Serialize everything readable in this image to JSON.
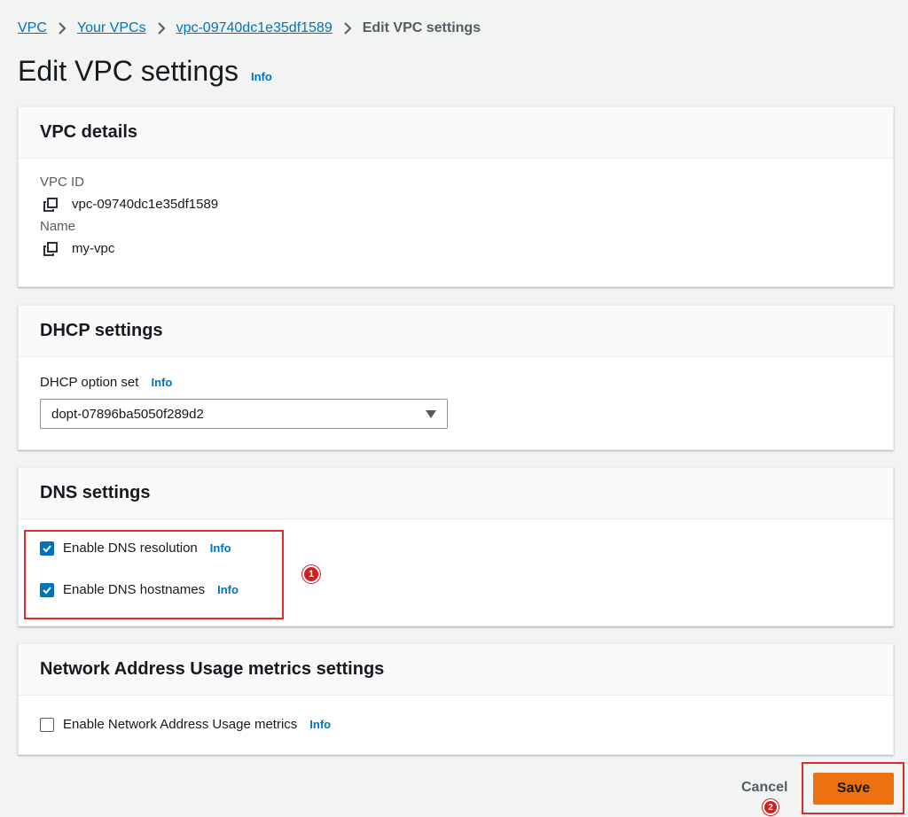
{
  "breadcrumb": {
    "items": [
      "VPC",
      "Your VPCs",
      "vpc-09740dc1e35df1589"
    ],
    "current": "Edit VPC settings"
  },
  "page": {
    "title": "Edit VPC settings",
    "info": "Info"
  },
  "vpc_details": {
    "heading": "VPC details",
    "id_label": "VPC ID",
    "id_value": "vpc-09740dc1e35df1589",
    "name_label": "Name",
    "name_value": "my-vpc"
  },
  "dhcp": {
    "heading": "DHCP settings",
    "option_label": "DHCP option set",
    "info": "Info",
    "selected": "dopt-07896ba5050f289d2"
  },
  "dns": {
    "heading": "DNS settings",
    "resolution_label": "Enable DNS resolution",
    "resolution_checked": true,
    "hostnames_label": "Enable DNS hostnames",
    "hostnames_checked": true,
    "info": "Info"
  },
  "nau": {
    "heading": "Network Address Usage metrics settings",
    "label": "Enable Network Address Usage metrics",
    "checked": false,
    "info": "Info"
  },
  "annotations": {
    "badge1": "1",
    "badge2": "2"
  },
  "actions": {
    "cancel": "Cancel",
    "save": "Save"
  },
  "colors": {
    "link": "#0073bb",
    "primary": "#ec7211",
    "checkbox": "#0073bb",
    "highlight": "#e02a2a"
  }
}
